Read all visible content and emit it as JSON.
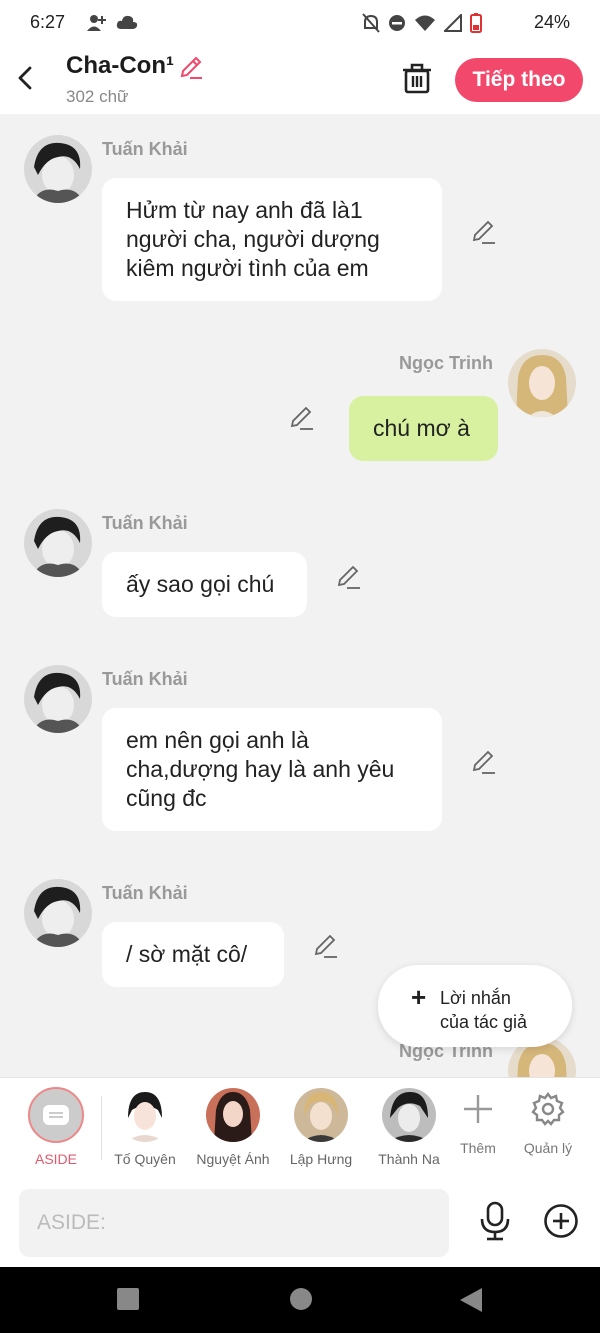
{
  "status_bar": {
    "time": "6:27",
    "battery": "24%"
  },
  "header": {
    "title": "Cha-Con¹",
    "subtitle": "302 chữ",
    "next_label": "Tiếp theo"
  },
  "messages": [
    {
      "sender": "Tuấn Khải",
      "text": "Hửm từ nay anh đã là1 người cha, người dượng kiêm người tình của em",
      "side": "left"
    },
    {
      "sender": "Ngọc Trinh",
      "text": "chú mơ à",
      "side": "right"
    },
    {
      "sender": "Tuấn Khải",
      "text": "ấy sao gọi chú",
      "side": "left"
    },
    {
      "sender": "Tuấn Khải",
      "text": "em nên gọi anh là cha,dượng hay là anh yêu cũng đc",
      "side": "left"
    },
    {
      "sender": "Tuấn Khải",
      "text": "/ sờ mặt cô/",
      "side": "left"
    },
    {
      "sender": "Ngọc Trinh",
      "text": "",
      "side": "right"
    }
  ],
  "author_note": {
    "icon": "plus-icon",
    "line1": "Lời nhắn",
    "line2": "của tác giả"
  },
  "characters": {
    "aside_label": "ASIDE",
    "items": [
      {
        "name": "Tố Quyên"
      },
      {
        "name": "Nguyệt Ánh"
      },
      {
        "name": "Lập Hưng"
      },
      {
        "name": "Thành Na"
      }
    ],
    "add_label": "Thêm",
    "manage_label": "Quản lý"
  },
  "input": {
    "placeholder": "ASIDE:"
  },
  "colors": {
    "accent": "#f1486b",
    "bubble_self": "#d8f1a0",
    "background": "#f2f2f2"
  }
}
